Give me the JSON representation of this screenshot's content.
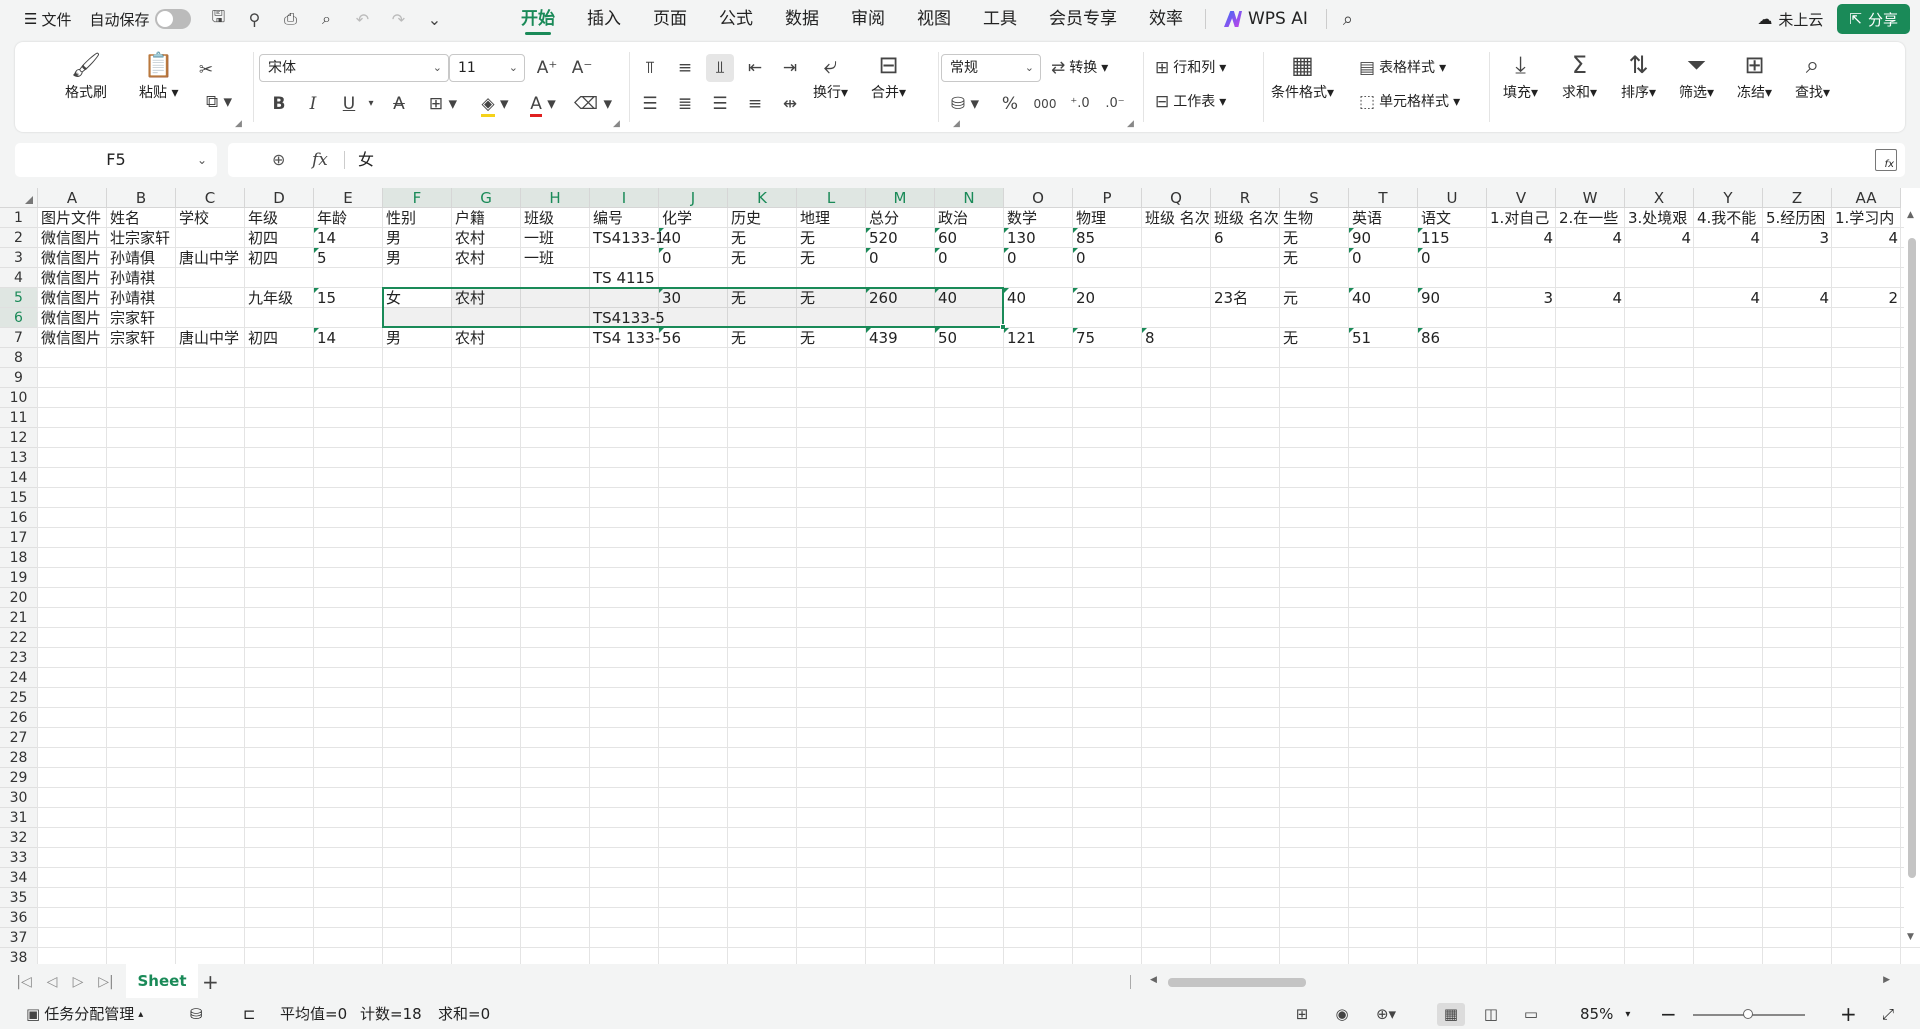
{
  "topbar": {
    "menu_label": "文件",
    "autosave_label": "自动保存",
    "tabs": [
      "开始",
      "插入",
      "页面",
      "公式",
      "数据",
      "审阅",
      "视图",
      "工具",
      "会员专享",
      "效率"
    ],
    "active_tab": "开始",
    "wps_ai_label": "WPS AI",
    "cloud_label": "未上云",
    "share_label": "分享"
  },
  "ribbon": {
    "format_painter": "格式刷",
    "paste": "粘贴",
    "font_name": "宋体",
    "font_size": "11",
    "bold": "B",
    "italic": "I",
    "underline": "U",
    "wrap": "换行",
    "merge": "合并",
    "number_format": "常规",
    "convert": "转换",
    "rows_cols": "行和列",
    "worksheet": "工作表",
    "conditional_format": "条件格式",
    "table_style": "表格样式",
    "cell_style": "单元格样式",
    "fill": "填充",
    "sum": "求和",
    "sort": "排序",
    "filter": "筛选",
    "freeze": "冻结",
    "find": "查找",
    "percent": "%",
    "thousands": "000"
  },
  "formula_bar": {
    "name_box": "F5",
    "fx_label": "fx",
    "value": "女"
  },
  "grid": {
    "columns": [
      "A",
      "B",
      "C",
      "D",
      "E",
      "F",
      "G",
      "H",
      "I",
      "J",
      "K",
      "L",
      "M",
      "N",
      "O",
      "P",
      "Q",
      "R",
      "S",
      "T",
      "U",
      "V",
      "W",
      "X",
      "Y",
      "Z",
      "AA"
    ],
    "selected_columns": [
      "F",
      "G",
      "H",
      "I",
      "J",
      "K",
      "L",
      "M",
      "N"
    ],
    "row_numbers": [
      "1",
      "2",
      "3",
      "4",
      "5",
      "6",
      "7",
      "8",
      "9",
      "10",
      "11",
      "12",
      "13",
      "14",
      "15",
      "16",
      "17",
      "18",
      "19",
      "20",
      "21",
      "22",
      "23",
      "24",
      "25",
      "26",
      "27",
      "28",
      "29",
      "30",
      "31",
      "32",
      "33",
      "34",
      "35",
      "36",
      "37",
      "38"
    ],
    "selected_rows": [
      "5",
      "6"
    ],
    "rows": [
      [
        "图片文件",
        "姓名",
        "学校",
        "年级",
        "年龄",
        "性别",
        "户籍",
        "班级",
        "编号",
        "化学",
        "历史",
        "地理",
        "总分",
        "政治",
        "数学",
        "物理",
        "班级 名次",
        "班级 名次",
        "生物",
        "英语",
        "语文",
        "1.对自己",
        "2.在一些",
        "3.处境艰",
        "4.我不能",
        "5.经历困",
        "1.学习内"
      ],
      [
        "微信图片",
        "壮宗家轩",
        "",
        "初四",
        "14",
        "男",
        "农村",
        "一班",
        "TS4133-1",
        "40",
        "无",
        "无",
        "520",
        "60",
        "130",
        "85",
        "",
        "6",
        "无",
        "90",
        "115",
        "4",
        "4",
        "4",
        "4",
        "3",
        "4"
      ],
      [
        "微信图片",
        "孙靖俱",
        "唐山中学",
        "初四",
        "5",
        "男",
        "农村",
        "一班",
        "",
        "0",
        "无",
        "无",
        "0",
        "0",
        "0",
        "0",
        "",
        "",
        "无",
        "0",
        "0",
        "",
        "",
        "",
        "",
        "",
        ""
      ],
      [
        "微信图片",
        "孙靖祺",
        "",
        "",
        "",
        "",
        "",
        "",
        "TS 4115",
        "",
        "",
        "",
        "",
        "",
        "",
        "",
        "",
        "",
        "",
        "",
        "",
        "",
        "",
        "",
        "",
        "",
        ""
      ],
      [
        "微信图片",
        "孙靖祺",
        "",
        "九年级",
        "15",
        "女",
        "农村",
        "",
        "",
        "30",
        "无",
        "无",
        "260",
        "40",
        "40",
        "20",
        "",
        "23名",
        "元",
        "40",
        "90",
        "3",
        "4",
        "",
        "4",
        "4",
        "2"
      ],
      [
        "微信图片",
        "宗家轩",
        "",
        "",
        "",
        "",
        "",
        "",
        "TS4133-5",
        "",
        "",
        "",
        "",
        "",
        "",
        "",
        "",
        "",
        "",
        "",
        "",
        "",
        "",
        "",
        "",
        "",
        ""
      ],
      [
        "微信图片",
        "宗家轩",
        "唐山中学",
        "初四",
        "14",
        "男",
        "农村",
        "",
        "TS4 133-",
        "56",
        "无",
        "无",
        "439",
        "50",
        "121",
        "75",
        "8",
        "",
        "无",
        "51",
        "86",
        "",
        "",
        "",
        "",
        "",
        ""
      ]
    ]
  },
  "sheets": {
    "tabs": [
      "Sheet"
    ],
    "active": "Sheet"
  },
  "status": {
    "task_label": "任务分配管理",
    "average": "平均值=0",
    "count": "计数=18",
    "sum": "求和=0",
    "zoom": "85%"
  }
}
